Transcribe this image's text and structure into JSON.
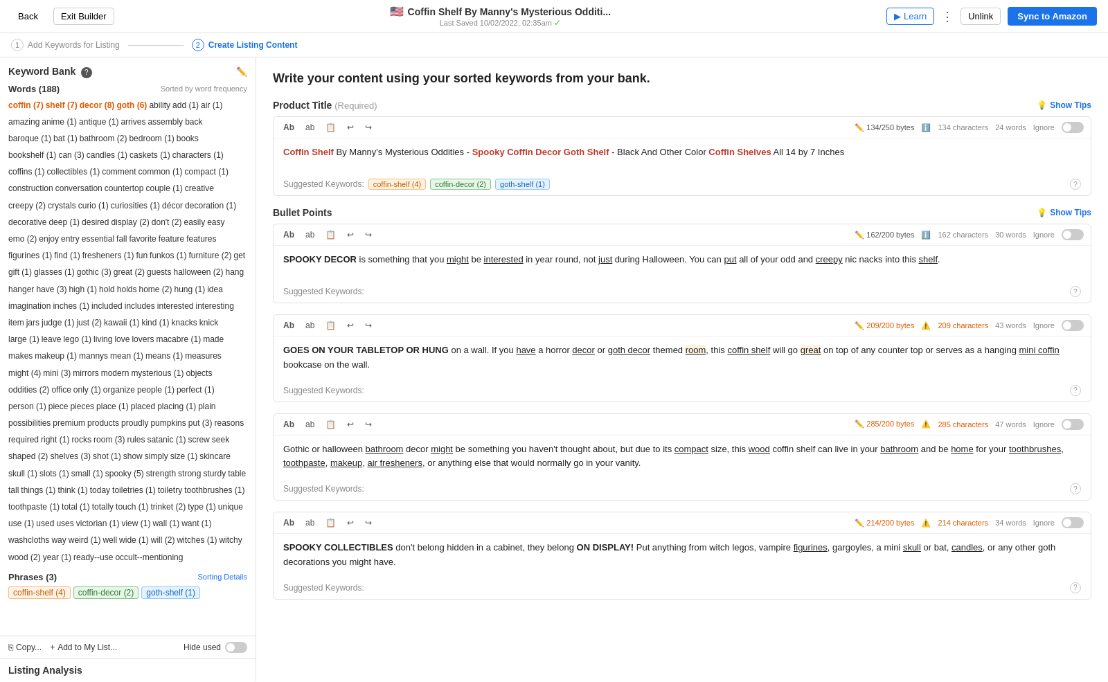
{
  "nav": {
    "back": "Back",
    "exit": "Exit Builder",
    "title": "Coffin Shelf By Manny's Mysterious Odditi...",
    "saved": "Last Saved 10/02/2022, 02:35am",
    "learn": "Learn",
    "unlink": "Unlink",
    "sync": "Sync to Amazon"
  },
  "steps": [
    {
      "num": "1",
      "label": "Add Keywords for Listing"
    },
    {
      "num": "2",
      "label": "Create Listing Content",
      "active": true
    }
  ],
  "sidebar": {
    "title": "Keyword Bank",
    "words_count": "Words (188)",
    "sort_label": "Sorted by word frequency",
    "keywords": [
      {
        "text": "coffin (7)",
        "type": "highlight"
      },
      {
        "text": "shelf (7)",
        "type": "highlight"
      },
      {
        "text": "decor (8)",
        "type": "highlight"
      },
      {
        "text": "goth (6)",
        "type": "highlight"
      },
      {
        "text": "ability",
        "type": "normal"
      },
      {
        "text": "add (1)",
        "type": "normal"
      },
      {
        "text": "air (1)",
        "type": "normal"
      },
      {
        "text": "amazing",
        "type": "normal"
      },
      {
        "text": "anime (1)",
        "type": "normal"
      },
      {
        "text": "antique (1)",
        "type": "normal"
      },
      {
        "text": "arrives",
        "type": "normal"
      },
      {
        "text": "assembly",
        "type": "normal"
      },
      {
        "text": "back",
        "type": "normal"
      },
      {
        "text": "baroque (1)",
        "type": "normal"
      },
      {
        "text": "bat (1)",
        "type": "normal"
      },
      {
        "text": "bathroom (2)",
        "type": "normal"
      },
      {
        "text": "bedroom (1)",
        "type": "normal"
      },
      {
        "text": "books",
        "type": "normal"
      },
      {
        "text": "bookshelf (1)",
        "type": "normal"
      },
      {
        "text": "can (3)",
        "type": "normal"
      },
      {
        "text": "candles (1)",
        "type": "normal"
      },
      {
        "text": "caskets (1)",
        "type": "normal"
      },
      {
        "text": "characters (1)",
        "type": "normal"
      },
      {
        "text": "coffins (1)",
        "type": "normal"
      },
      {
        "text": "collectibles (1)",
        "type": "normal"
      },
      {
        "text": "comment",
        "type": "normal"
      },
      {
        "text": "common (1)",
        "type": "normal"
      },
      {
        "text": "compact (1)",
        "type": "normal"
      },
      {
        "text": "construction",
        "type": "normal"
      },
      {
        "text": "conversation",
        "type": "normal"
      },
      {
        "text": "countertop",
        "type": "normal"
      },
      {
        "text": "couple (1)",
        "type": "normal"
      },
      {
        "text": "creative",
        "type": "normal"
      },
      {
        "text": "creepy (2)",
        "type": "normal"
      },
      {
        "text": "crystals",
        "type": "normal"
      },
      {
        "text": "curio (1)",
        "type": "normal"
      },
      {
        "text": "curiosities (1)",
        "type": "normal"
      },
      {
        "text": "décor",
        "type": "normal"
      },
      {
        "text": "decoration (1)",
        "type": "normal"
      },
      {
        "text": "decorative",
        "type": "normal"
      },
      {
        "text": "deep (1)",
        "type": "normal"
      },
      {
        "text": "desired",
        "type": "normal"
      },
      {
        "text": "display (2)",
        "type": "normal"
      },
      {
        "text": "don't (2)",
        "type": "normal"
      },
      {
        "text": "easily",
        "type": "normal"
      },
      {
        "text": "easy",
        "type": "normal"
      },
      {
        "text": "emo (2)",
        "type": "normal"
      },
      {
        "text": "enjoy",
        "type": "normal"
      },
      {
        "text": "entry",
        "type": "normal"
      },
      {
        "text": "essential",
        "type": "normal"
      },
      {
        "text": "fall",
        "type": "normal"
      },
      {
        "text": "favorite",
        "type": "normal"
      },
      {
        "text": "feature",
        "type": "normal"
      },
      {
        "text": "features",
        "type": "normal"
      },
      {
        "text": "figurines (1)",
        "type": "normal"
      },
      {
        "text": "find (1)",
        "type": "normal"
      },
      {
        "text": "fresheners (1)",
        "type": "normal"
      },
      {
        "text": "fun",
        "type": "normal"
      },
      {
        "text": "funkos (1)",
        "type": "normal"
      },
      {
        "text": "furniture (2)",
        "type": "normal"
      },
      {
        "text": "get",
        "type": "normal"
      },
      {
        "text": "gift (1)",
        "type": "normal"
      },
      {
        "text": "glasses (1)",
        "type": "normal"
      },
      {
        "text": "gothic (3)",
        "type": "normal"
      },
      {
        "text": "great (2)",
        "type": "normal"
      },
      {
        "text": "guests",
        "type": "normal"
      },
      {
        "text": "halloween (2)",
        "type": "normal"
      },
      {
        "text": "hang",
        "type": "normal"
      },
      {
        "text": "hanger",
        "type": "normal"
      },
      {
        "text": "have (3)",
        "type": "normal"
      },
      {
        "text": "high (1)",
        "type": "normal"
      },
      {
        "text": "hold",
        "type": "normal"
      },
      {
        "text": "holds",
        "type": "normal"
      },
      {
        "text": "home (2)",
        "type": "normal"
      },
      {
        "text": "hung (1)",
        "type": "normal"
      },
      {
        "text": "idea",
        "type": "normal"
      },
      {
        "text": "imagination",
        "type": "normal"
      },
      {
        "text": "inches (1)",
        "type": "normal"
      },
      {
        "text": "included",
        "type": "normal"
      },
      {
        "text": "includes",
        "type": "normal"
      },
      {
        "text": "interested",
        "type": "normal"
      },
      {
        "text": "interesting",
        "type": "normal"
      },
      {
        "text": "item",
        "type": "normal"
      },
      {
        "text": "jars",
        "type": "normal"
      },
      {
        "text": "judge (1)",
        "type": "normal"
      },
      {
        "text": "just (2)",
        "type": "normal"
      },
      {
        "text": "kawaii (1)",
        "type": "normal"
      },
      {
        "text": "kind (1)",
        "type": "normal"
      },
      {
        "text": "knacks",
        "type": "normal"
      },
      {
        "text": "knick",
        "type": "normal"
      },
      {
        "text": "large (1)",
        "type": "normal"
      },
      {
        "text": "leave",
        "type": "normal"
      },
      {
        "text": "lego (1)",
        "type": "normal"
      },
      {
        "text": "living",
        "type": "normal"
      },
      {
        "text": "love",
        "type": "normal"
      },
      {
        "text": "lovers",
        "type": "normal"
      },
      {
        "text": "macabre (1)",
        "type": "normal"
      },
      {
        "text": "made",
        "type": "normal"
      },
      {
        "text": "makes",
        "type": "normal"
      },
      {
        "text": "makeup (1)",
        "type": "normal"
      },
      {
        "text": "mannys",
        "type": "normal"
      },
      {
        "text": "mean (1)",
        "type": "normal"
      },
      {
        "text": "means (1)",
        "type": "normal"
      },
      {
        "text": "measures",
        "type": "normal"
      },
      {
        "text": "might (4)",
        "type": "normal"
      },
      {
        "text": "mini (3)",
        "type": "normal"
      },
      {
        "text": "mirrors",
        "type": "normal"
      },
      {
        "text": "modern",
        "type": "normal"
      },
      {
        "text": "mysterious (1)",
        "type": "normal"
      },
      {
        "text": "objects",
        "type": "normal"
      },
      {
        "text": "oddities (2)",
        "type": "normal"
      },
      {
        "text": "office",
        "type": "normal"
      },
      {
        "text": "only (1)",
        "type": "normal"
      },
      {
        "text": "organize",
        "type": "normal"
      },
      {
        "text": "people (1)",
        "type": "normal"
      },
      {
        "text": "perfect (1)",
        "type": "normal"
      },
      {
        "text": "person (1)",
        "type": "normal"
      },
      {
        "text": "piece",
        "type": "normal"
      },
      {
        "text": "pieces",
        "type": "normal"
      },
      {
        "text": "place (1)",
        "type": "normal"
      },
      {
        "text": "placed",
        "type": "normal"
      },
      {
        "text": "placing (1)",
        "type": "normal"
      },
      {
        "text": "plain",
        "type": "normal"
      },
      {
        "text": "possibilities",
        "type": "normal"
      },
      {
        "text": "premium",
        "type": "normal"
      },
      {
        "text": "products",
        "type": "normal"
      },
      {
        "text": "proudly",
        "type": "normal"
      },
      {
        "text": "pumpkins",
        "type": "normal"
      },
      {
        "text": "put (3)",
        "type": "normal"
      },
      {
        "text": "reasons",
        "type": "normal"
      },
      {
        "text": "required",
        "type": "normal"
      },
      {
        "text": "right (1)",
        "type": "normal"
      },
      {
        "text": "rocks",
        "type": "normal"
      },
      {
        "text": "room (3)",
        "type": "normal"
      },
      {
        "text": "rules",
        "type": "normal"
      },
      {
        "text": "satanic (1)",
        "type": "normal"
      },
      {
        "text": "screw",
        "type": "normal"
      },
      {
        "text": "seek",
        "type": "normal"
      },
      {
        "text": "shaped (2)",
        "type": "normal"
      },
      {
        "text": "shelves (3)",
        "type": "normal"
      },
      {
        "text": "shot (1)",
        "type": "normal"
      },
      {
        "text": "show",
        "type": "normal"
      },
      {
        "text": "simply",
        "type": "normal"
      },
      {
        "text": "size (1)",
        "type": "normal"
      },
      {
        "text": "skincare",
        "type": "normal"
      },
      {
        "text": "skull (1)",
        "type": "normal"
      },
      {
        "text": "slots (1)",
        "type": "normal"
      },
      {
        "text": "small (1)",
        "type": "normal"
      },
      {
        "text": "spooky (5)",
        "type": "normal"
      },
      {
        "text": "strength",
        "type": "normal"
      },
      {
        "text": "strong",
        "type": "normal"
      },
      {
        "text": "sturdy",
        "type": "normal"
      },
      {
        "text": "table",
        "type": "normal"
      },
      {
        "text": "tall",
        "type": "normal"
      },
      {
        "text": "things (1)",
        "type": "normal"
      },
      {
        "text": "think (1)",
        "type": "normal"
      },
      {
        "text": "today",
        "type": "normal"
      },
      {
        "text": "toiletries (1)",
        "type": "normal"
      },
      {
        "text": "toiletry",
        "type": "normal"
      },
      {
        "text": "toothbrushes (1)",
        "type": "normal"
      },
      {
        "text": "toothpaste (1)",
        "type": "normal"
      },
      {
        "text": "total (1)",
        "type": "normal"
      },
      {
        "text": "totally",
        "type": "normal"
      },
      {
        "text": "touch (1)",
        "type": "normal"
      },
      {
        "text": "trinket (2)",
        "type": "normal"
      },
      {
        "text": "type (1)",
        "type": "normal"
      },
      {
        "text": "unique",
        "type": "normal"
      },
      {
        "text": "use (1)",
        "type": "normal"
      },
      {
        "text": "used",
        "type": "normal"
      },
      {
        "text": "uses",
        "type": "normal"
      },
      {
        "text": "victorian (1)",
        "type": "normal"
      },
      {
        "text": "view (1)",
        "type": "normal"
      },
      {
        "text": "wall (1)",
        "type": "normal"
      },
      {
        "text": "want (1)",
        "type": "normal"
      },
      {
        "text": "washcloths",
        "type": "normal"
      },
      {
        "text": "way",
        "type": "normal"
      },
      {
        "text": "weird (1)",
        "type": "normal"
      },
      {
        "text": "well",
        "type": "normal"
      },
      {
        "text": "wide (1)",
        "type": "normal"
      },
      {
        "text": "will (2)",
        "type": "normal"
      },
      {
        "text": "witches (1)",
        "type": "normal"
      },
      {
        "text": "witchy",
        "type": "normal"
      },
      {
        "text": "wood (2)",
        "type": "normal"
      },
      {
        "text": "year (1)",
        "type": "normal"
      },
      {
        "text": "ready--use",
        "type": "normal"
      },
      {
        "text": "occult--mentioning",
        "type": "normal"
      }
    ],
    "phrases_count": "Phrases (3)",
    "phrases": [
      {
        "text": "coffin-shelf (4)",
        "type": "orange"
      },
      {
        "text": "coffin-decor (2)",
        "type": "green"
      },
      {
        "text": "goth-shelf (1)",
        "type": "blue"
      }
    ],
    "copy_btn": "Copy...",
    "add_list_btn": "Add to My List...",
    "hide_used": "Hide used"
  },
  "content": {
    "header": "Write your content using your sorted keywords from your bank.",
    "product_title_label": "Product Title",
    "required": "(Required)",
    "show_tips": "Show Tips",
    "bullet_points_label": "Bullet Points",
    "title_bytes": "134/250 bytes",
    "title_chars": "134 characters",
    "title_words": "24 words",
    "title_text": "Coffin Shelf By Manny's Mysterious Oddities - Spooky Coffin Decor Goth Shelf - Black And Other Color Coffin Shelves All 14 by 7 Inches",
    "title_suggested": "Suggested Keywords:",
    "title_sug_tags": [
      "coffin-shelf (4)",
      "coffin-decor (2)",
      "goth-shelf (1)"
    ],
    "bp1_bytes": "162/200 bytes",
    "bp1_chars": "162 characters",
    "bp1_words": "30 words",
    "bp1_text": "SPOOKY DECOR is something that you might be interested in year round, not just during Halloween. You can put all of your odd and creepy nic nacks into this shelf.",
    "bp2_bytes": "209/200 bytes",
    "bp2_chars": "209 characters",
    "bp2_words": "43 words",
    "bp2_text": "GOES ON YOUR TABLETOP OR HUNG on a wall. If you have a horror decor or goth decor themed room, this coffin shelf will go great on top of any counter top or serves as a hanging mini coffin bookcase on the wall.",
    "bp3_bytes": "285/200 bytes",
    "bp3_chars": "285 characters",
    "bp3_words": "47 words",
    "bp3_text": "Gothic or halloween bathroom decor might be something you haven't thought about, but due to its compact size, this wood coffin shelf can live in your bathroom and be home for your toothbrushes, toothpaste, makeup, air fresheners, or anything else that would normally go in your vanity.",
    "bp4_bytes": "214/200 bytes",
    "bp4_chars": "214 characters",
    "bp4_words": "34 words",
    "bp4_text": "SPOOKY COLLECTIBLES don't belong hidden in a cabinet, they belong ON DISPLAY! Put anything from witch legos, vampire figurines, gargoyles, a mini skull or bat, candles, or any other goth decorations you might have.",
    "listing_analysis": "Listing Analysis",
    "ignore": "Ignore"
  }
}
